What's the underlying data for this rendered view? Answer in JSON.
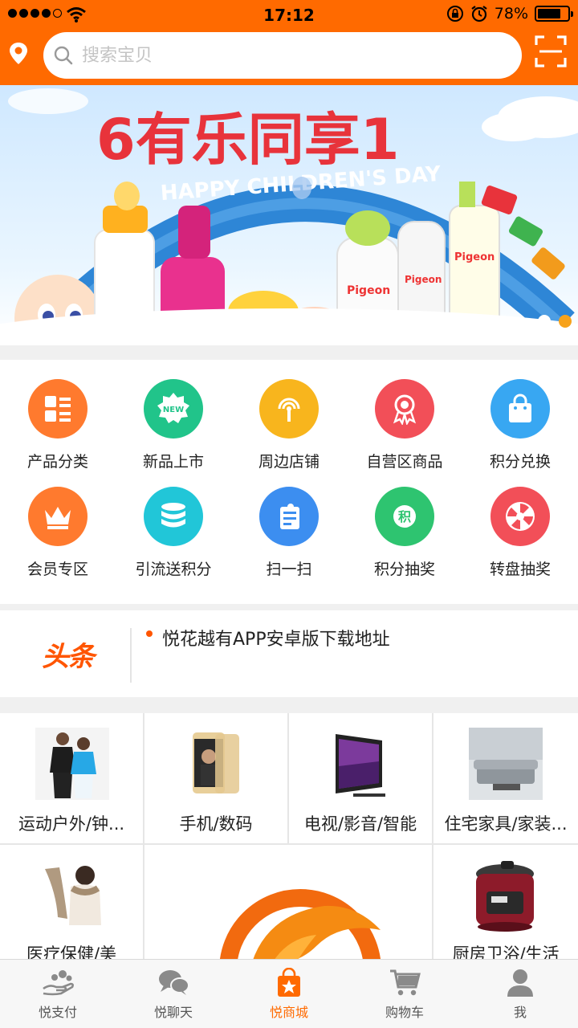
{
  "status_bar": {
    "time": "17:12",
    "battery": "78%",
    "battery_level": 0.78
  },
  "search": {
    "placeholder": "搜索宝贝"
  },
  "banner": {
    "title": "6有乐同享1",
    "subtitle": "HAPPY CHILDREN'S DAY",
    "brand": "Pigeon",
    "slide_count": 2,
    "active_slide": 2
  },
  "menu": {
    "items": [
      {
        "label": "产品分类",
        "icon": "category-icon",
        "color": "#ff7a2e"
      },
      {
        "label": "新品上市",
        "icon": "new-icon",
        "color": "#21c48a"
      },
      {
        "label": "周边店铺",
        "icon": "nearby-store-icon",
        "color": "#f8b51d"
      },
      {
        "label": "自营区商品",
        "icon": "ribbon-icon",
        "color": "#f24f58"
      },
      {
        "label": "积分兑换",
        "icon": "shopping-bag-icon",
        "color": "#38a7f2"
      },
      {
        "label": "会员专区",
        "icon": "crown-icon",
        "color": "#ff7a2e"
      },
      {
        "label": "引流送积分",
        "icon": "database-icon",
        "color": "#21c6d8"
      },
      {
        "label": "扫一扫",
        "icon": "scan-notes-icon",
        "color": "#3c8ef0"
      },
      {
        "label": "积分抽奖",
        "icon": "points-icon",
        "color": "#2ec470"
      },
      {
        "label": "转盘抽奖",
        "icon": "wheel-icon",
        "color": "#f24f58"
      }
    ]
  },
  "headline": {
    "logo": "头条",
    "text": "悦花越有APP安卓版下载地址"
  },
  "categories": [
    {
      "label": "运动户外/钟...",
      "icon": "sportswear-image"
    },
    {
      "label": "手机/数码",
      "icon": "phone-image"
    },
    {
      "label": "电视/影音/智能",
      "icon": "tv-image"
    },
    {
      "label": "住宅家具/家装...",
      "icon": "sofa-image"
    },
    {
      "label": "医疗保健/美",
      "icon": "massager-image"
    },
    {
      "label": "",
      "icon": "brand-logo-image"
    },
    {
      "label": "厨房卫浴/生活",
      "icon": "pressure-cooker-image"
    }
  ],
  "tabbar": {
    "items": [
      {
        "label": "悦支付",
        "icon": "payment-icon"
      },
      {
        "label": "悦聊天",
        "icon": "chat-icon"
      },
      {
        "label": "悦商城",
        "icon": "mall-icon",
        "active": true
      },
      {
        "label": "购物车",
        "icon": "cart-icon"
      },
      {
        "label": "我",
        "icon": "user-icon"
      }
    ]
  },
  "colors": {
    "brand": "#ff6a00",
    "accent": "#ff5500",
    "inactive": "#8a8a8a"
  }
}
